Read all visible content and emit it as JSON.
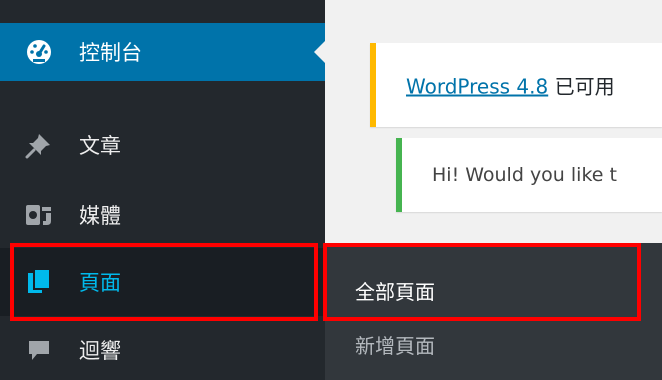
{
  "sidebar": {
    "items": [
      {
        "label": "控制台",
        "icon": "dashboard-icon"
      },
      {
        "label": "文章",
        "icon": "pin-icon"
      },
      {
        "label": "媒體",
        "icon": "media-icon"
      },
      {
        "label": "頁面",
        "icon": "pages-icon"
      },
      {
        "label": "迴響",
        "icon": "comment-icon"
      }
    ]
  },
  "submenu": {
    "items": [
      {
        "label": "全部頁面"
      },
      {
        "label": "新增頁面"
      }
    ]
  },
  "notices": {
    "update": {
      "link": "WordPress 4.8",
      "text": " 已可用"
    },
    "welcome": {
      "text": "Hi! Would you like t"
    }
  },
  "colors": {
    "sidebar_bg": "#23282d",
    "active_bg": "#0073aa",
    "pages_text": "#00b9eb",
    "highlight": "#ff0000",
    "update_border": "#ffb900",
    "welcome_border": "#46b450"
  }
}
